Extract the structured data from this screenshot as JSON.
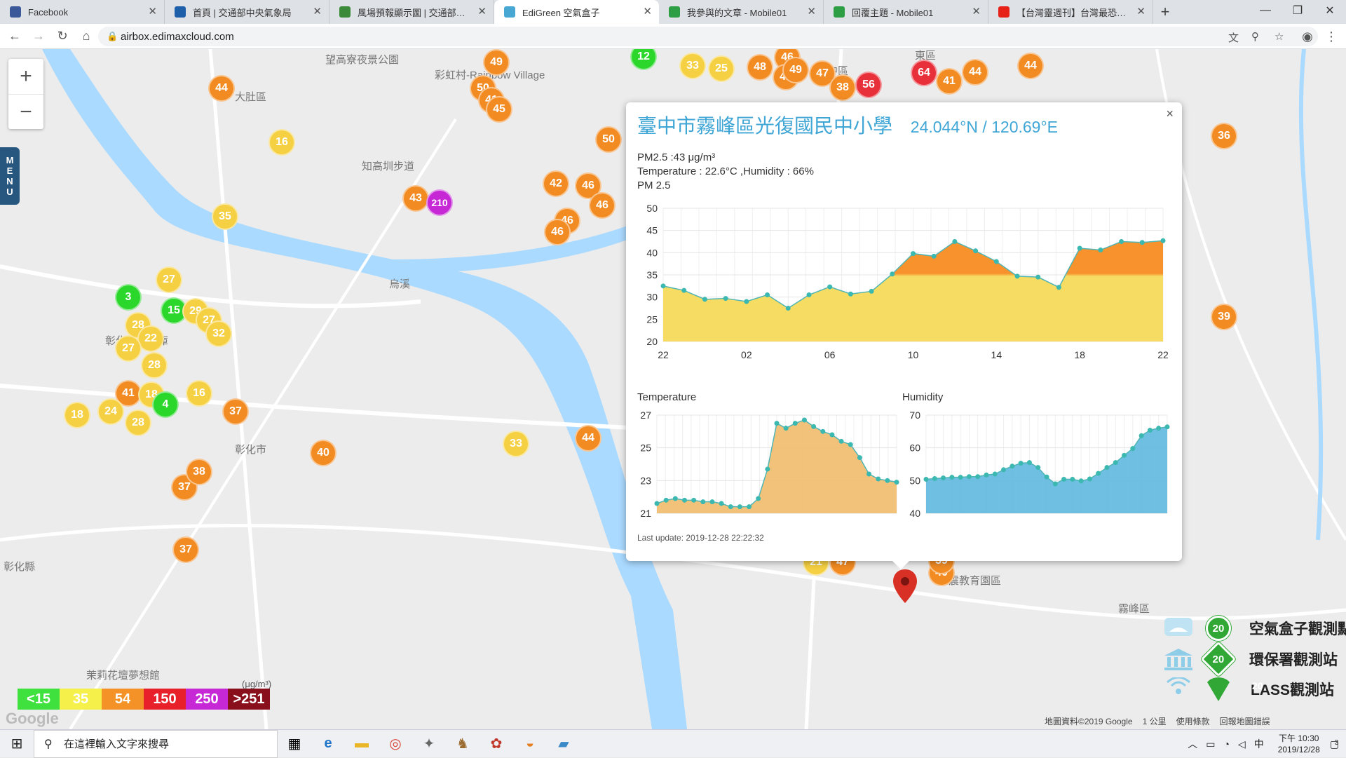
{
  "browser": {
    "tabs": [
      {
        "title": "Facebook",
        "icon": "facebook-icon",
        "color": "#3b5998",
        "active": false
      },
      {
        "title": "首頁 | 交通部中央氣象局",
        "icon": "cwb-icon",
        "color": "#1d5fa9",
        "active": false
      },
      {
        "title": "風場預報顯示圖 | 交通部中央氣象局",
        "icon": "weather-map-icon",
        "color": "#3a8a3a",
        "active": false
      },
      {
        "title": "EdiGreen 空氣盒子",
        "icon": "edigreen-icon",
        "color": "#48a7d3",
        "active": true
      },
      {
        "title": "我參與的文章 - Mobile01",
        "icon": "mobile01-icon",
        "color": "#2e9e45",
        "active": false
      },
      {
        "title": "回覆主題 - Mobile01",
        "icon": "mobile01-icon",
        "color": "#2e9e45",
        "active": false
      },
      {
        "title": "【台灣靈週刊】台灣最恐怖的核廢",
        "icon": "youtube-icon",
        "color": "#e62117",
        "active": false
      }
    ],
    "url": "airbox.edimaxcloud.com"
  },
  "map": {
    "labels": [
      {
        "text": "望高寮夜景公園"
      },
      {
        "text": "大肚區"
      },
      {
        "text": "彩虹村-Rainbow Village"
      },
      {
        "text": "知高圳步道"
      },
      {
        "text": "中區"
      },
      {
        "text": "東區"
      },
      {
        "text": "彰化扇形車庫"
      },
      {
        "text": "彰化市"
      },
      {
        "text": "茉莉花壇夢想館"
      },
      {
        "text": "霧峰區"
      },
      {
        "text": "地震教育園區"
      },
      {
        "text": "烏溪"
      },
      {
        "text": "彰化縣"
      }
    ],
    "markers": [
      {
        "value": "44",
        "color": "orange"
      },
      {
        "value": "49",
        "color": "orange"
      },
      {
        "value": "50",
        "color": "orange"
      },
      {
        "value": "41",
        "color": "orange"
      },
      {
        "value": "45",
        "color": "orange"
      },
      {
        "value": "12",
        "color": "green"
      },
      {
        "value": "33",
        "color": "yellow"
      },
      {
        "value": "25",
        "color": "yellow"
      },
      {
        "value": "46",
        "color": "orange"
      },
      {
        "value": "48",
        "color": "orange"
      },
      {
        "value": "42",
        "color": "orange"
      },
      {
        "value": "49",
        "color": "orange"
      },
      {
        "value": "47",
        "color": "orange"
      },
      {
        "value": "38",
        "color": "orange"
      },
      {
        "value": "56",
        "color": "red"
      },
      {
        "value": "64",
        "color": "red"
      },
      {
        "value": "41",
        "color": "orange"
      },
      {
        "value": "44",
        "color": "orange"
      },
      {
        "value": "44",
        "color": "orange"
      },
      {
        "value": "16",
        "color": "yellow"
      },
      {
        "value": "50",
        "color": "orange"
      },
      {
        "value": "43",
        "color": "orange"
      },
      {
        "value": "210",
        "color": "purple"
      },
      {
        "value": "42",
        "color": "orange"
      },
      {
        "value": "46",
        "color": "orange"
      },
      {
        "value": "46",
        "color": "orange"
      },
      {
        "value": "46",
        "color": "orange"
      },
      {
        "value": "46",
        "color": "orange"
      },
      {
        "value": "35",
        "color": "yellow"
      },
      {
        "value": "27",
        "color": "yellow"
      },
      {
        "value": "3",
        "color": "green"
      },
      {
        "value": "15",
        "color": "green"
      },
      {
        "value": "29",
        "color": "yellow"
      },
      {
        "value": "27",
        "color": "yellow"
      },
      {
        "value": "28",
        "color": "yellow"
      },
      {
        "value": "22",
        "color": "yellow"
      },
      {
        "value": "32",
        "color": "yellow"
      },
      {
        "value": "27",
        "color": "yellow"
      },
      {
        "value": "28",
        "color": "yellow"
      },
      {
        "value": "41",
        "color": "orange"
      },
      {
        "value": "18",
        "color": "yellow"
      },
      {
        "value": "4",
        "color": "green"
      },
      {
        "value": "16",
        "color": "yellow"
      },
      {
        "value": "24",
        "color": "yellow"
      },
      {
        "value": "18",
        "color": "yellow"
      },
      {
        "value": "28",
        "color": "yellow"
      },
      {
        "value": "37",
        "color": "orange"
      },
      {
        "value": "37",
        "color": "orange"
      },
      {
        "value": "40",
        "color": "orange"
      },
      {
        "value": "38",
        "color": "orange"
      },
      {
        "value": "37",
        "color": "orange"
      },
      {
        "value": "36",
        "color": "orange"
      },
      {
        "value": "33",
        "color": "yellow"
      },
      {
        "value": "44",
        "color": "orange"
      },
      {
        "value": "43",
        "color": "orange"
      },
      {
        "value": "43",
        "color": "orange"
      },
      {
        "value": "39",
        "color": "orange"
      },
      {
        "value": "39",
        "color": "orange"
      },
      {
        "value": "21",
        "color": "yellow"
      },
      {
        "value": "47",
        "color": "orange"
      },
      {
        "value": "40",
        "color": "orange"
      },
      {
        "value": "36",
        "color": "orange"
      },
      {
        "value": "39",
        "color": "orange"
      }
    ],
    "zoom_in": "+",
    "zoom_out": "−",
    "menu_label": [
      "M",
      "E",
      "N",
      "U"
    ]
  },
  "popup": {
    "title": "臺中市霧峰區光復國民中小學",
    "coords": "24.044°N / 120.69°E",
    "pm_line": "PM2.5 :43 μg/m³",
    "temp_hum_line": "Temperature : 22.6°C ,Humidity : 66%",
    "pm_chart_label": "PM 2.5",
    "temp_chart_label": "Temperature",
    "hum_chart_label": "Humidity",
    "last_update": "Last update: 2019-12-28 22:22:32",
    "close_label": "×"
  },
  "chart_data": [
    {
      "type": "area",
      "title": "PM 2.5",
      "x": [
        "22",
        "",
        "00",
        "",
        "02",
        "",
        "04",
        "",
        "06",
        "",
        "08",
        "",
        "10",
        "",
        "12",
        "",
        "14",
        "",
        "16",
        "",
        "18",
        "",
        "20",
        "",
        "22"
      ],
      "xticks": [
        "22",
        "02",
        "06",
        "10",
        "14",
        "18",
        "22"
      ],
      "values": [
        32.5,
        31.5,
        29.5,
        29.7,
        29,
        30.5,
        27.5,
        30.5,
        32.3,
        30.7,
        31.3,
        35.2,
        39.8,
        39.2,
        42.5,
        40.4,
        38,
        34.7,
        34.5,
        32.2,
        41,
        40.6,
        42.5,
        42.3,
        42.7
      ],
      "ylim": [
        20,
        50
      ],
      "yticks": [
        20,
        25,
        30,
        35,
        40,
        45,
        50
      ],
      "threshold": 35,
      "color_low": "#f6dc62",
      "color_high": "#f7922c"
    },
    {
      "type": "area",
      "title": "Temperature",
      "values": [
        21.6,
        21.8,
        21.9,
        21.8,
        21.8,
        21.7,
        21.7,
        21.6,
        21.4,
        21.4,
        21.4,
        21.9,
        23.7,
        26.5,
        26.2,
        26.5,
        26.7,
        26.3,
        26,
        25.8,
        25.4,
        25.2,
        24.4,
        23.4,
        23.1,
        23,
        22.9
      ],
      "ylim": [
        21,
        27
      ],
      "yticks": [
        21,
        23,
        25,
        27
      ],
      "color": "#f2bb6b"
    },
    {
      "type": "area",
      "title": "Humidity",
      "values": [
        50.4,
        50.6,
        50.8,
        51,
        51,
        51.2,
        51.2,
        51.7,
        52,
        53.3,
        54.4,
        55.3,
        55.5,
        54,
        51.1,
        49,
        50.4,
        50.4,
        49.9,
        50.5,
        52.2,
        54,
        55.5,
        57.7,
        59.8,
        63.7,
        65.4,
        66,
        66.4
      ],
      "ylim": [
        40,
        70
      ],
      "yticks": [
        40,
        50,
        60,
        70
      ],
      "color": "#5fb8df"
    }
  ],
  "scale": [
    {
      "label": "<15",
      "color": "#3fe13f"
    },
    {
      "label": "35",
      "color": "#f6f04a"
    },
    {
      "label": "54",
      "color": "#f59227"
    },
    {
      "label": "150",
      "color": "#e8202a"
    },
    {
      "label": "250",
      "color": "#c628d6"
    },
    {
      "label": ">251",
      "color": "#8a0f1c"
    }
  ],
  "scale_unit": "(μg/m³)",
  "legend": [
    {
      "badge": "20",
      "text": "空氣盒子觀測點",
      "icon": "airbox-icon"
    },
    {
      "badge": "20",
      "text": "環保署觀測站",
      "icon": "epa-building-icon"
    },
    {
      "badge": "20",
      "text": "LASS觀測站",
      "icon": "lass-signal-icon"
    }
  ],
  "map_footer": {
    "data_credit": "地圖資料©2019 Google",
    "scale": "1 公里",
    "terms": "使用條款",
    "report": "回報地圖錯誤",
    "google_logo": "Google"
  },
  "taskbar": {
    "search_placeholder": "在這裡輸入文字來搜尋",
    "time": "下午 10:30",
    "date": "2019/12/28",
    "ime": "中",
    "notifications": "3"
  }
}
